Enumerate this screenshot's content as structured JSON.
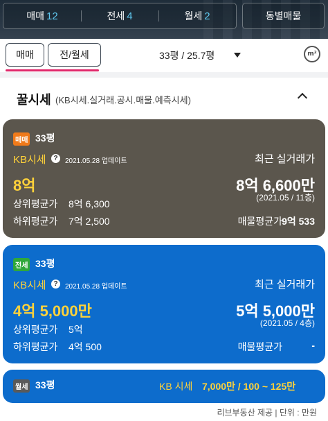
{
  "deal_tabs": [
    {
      "label": "매매",
      "count": "12"
    },
    {
      "label": "전세",
      "count": "4"
    },
    {
      "label": "월세",
      "count": "2"
    }
  ],
  "dong_button": "동별매물",
  "chips": [
    "매매",
    "전/월세"
  ],
  "area_select": "33평 / 25.7평",
  "m2_icon_text": "m²",
  "section": {
    "title": "꿀시세",
    "subtitle": "(KB시세.실거래.공시.매물.예측시세)"
  },
  "cards": {
    "sale": {
      "badge": "매매",
      "pyeong": "33평",
      "kb_label": "KB시세",
      "updated": "2021.05.28 업데이트",
      "recent_label": "최근 실거래가",
      "kb_price": "8억",
      "recent_price": "8억 6,600만",
      "recent_sub": "(2021.05 / 11층)",
      "upper_label": "상위평균가",
      "upper_value": "8억 6,300",
      "lower_label": "하위평균가",
      "lower_value": "7억 2,500",
      "listing_avg_label": "매물평균가",
      "listing_avg_value": "9억 533"
    },
    "jeonse": {
      "badge": "전세",
      "pyeong": "33평",
      "kb_label": "KB시세",
      "updated": "2021.05.28 업데이트",
      "recent_label": "최근 실거래가",
      "kb_price": "4억 5,000만",
      "recent_price": "5억 5,000만",
      "recent_sub": "(2021.05 / 4층)",
      "upper_label": "상위평균가",
      "upper_value": "5억",
      "lower_label": "하위평균가",
      "lower_value": "4억 500",
      "listing_avg_label": "매물평균가",
      "listing_avg_value": "-"
    },
    "wolse": {
      "badge": "월세",
      "pyeong": "33평",
      "kb_label": "KB 시세",
      "value": "7,000만 / 100 ~ 125만"
    }
  },
  "footnote": "리브부동산 제공  |  단위 : 만원",
  "colors": {
    "sale_card": "#5b564d",
    "jeonse_card": "#0d6ccc",
    "accent_yellow": "#ffd23a",
    "underline_pink": "#e0286a"
  }
}
